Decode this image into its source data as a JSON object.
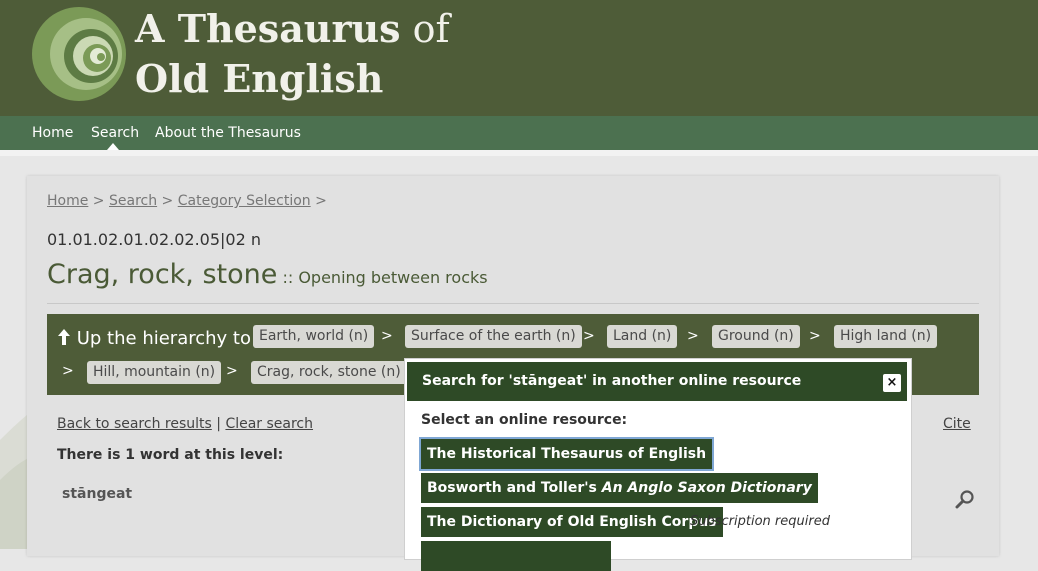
{
  "site": {
    "title_line1_bold": "A Thesaurus",
    "title_line1_of": "of",
    "title_line2": "Old English"
  },
  "nav": {
    "items": [
      "Home",
      "Search",
      "About the Thesaurus"
    ],
    "active": "Search"
  },
  "breadcrumb": {
    "items": [
      "Home",
      "Search",
      "Category Selection"
    ],
    "separator": ">"
  },
  "category": {
    "code": "01.01.02.01.02.02.05|02 n",
    "title": "Crag, rock, stone",
    "subtitle": ":: Opening between rocks"
  },
  "hierarchy": {
    "label": "Up the hierarchy to:",
    "separator": ">",
    "items": [
      "Earth, world (n)",
      "Surface of the earth (n)",
      "Land (n)",
      "Ground (n)",
      "High land (n)",
      "Hill, mountain (n)",
      "Crag, rock, stone (n)"
    ]
  },
  "results": {
    "back_link": "Back to search results",
    "divider": "|",
    "clear_link": "Clear search",
    "count_text": "There is 1 word at this level:",
    "word": "stāngeat",
    "cite": "Cite"
  },
  "modal": {
    "title": "Search for 'stāngeat' in another online resource",
    "close": "×",
    "select_label": "Select an online resource:",
    "resources": [
      {
        "label": "The Historical Thesaurus of English"
      },
      {
        "label_plain": "Bosworth and Toller's",
        "label_italic": "An Anglo Saxon Dictionary"
      },
      {
        "label": "The Dictionary of Old English Corpus",
        "note": "Subscription required"
      }
    ]
  },
  "colors": {
    "header": "#4e5c38",
    "nav": "#4c7150",
    "modal_header": "#2e4a26",
    "button": "#2e4a26",
    "page_bg": "#e7e7e7"
  }
}
